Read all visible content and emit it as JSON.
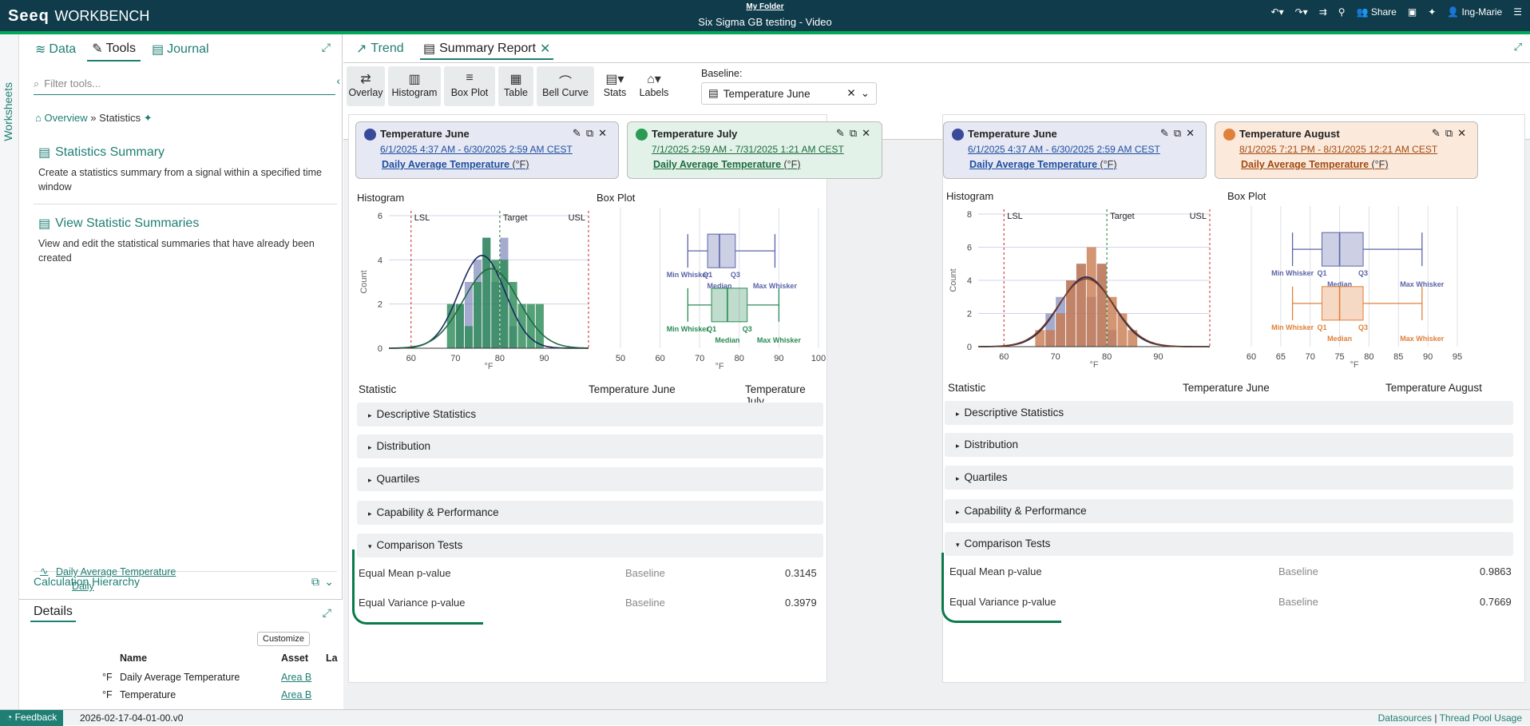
{
  "app": {
    "logo_seeq": "Seeq",
    "logo_workbench": "WORKBENCH",
    "folder": "My Folder",
    "title": "Six Sigma GB testing - Video",
    "share_label": "Share",
    "user": "Ing-Marie"
  },
  "sidebar": {
    "worksheets_label": "Worksheets"
  },
  "left": {
    "tabs": [
      {
        "label": "Data",
        "icon": "database-icon"
      },
      {
        "label": "Tools",
        "icon": "wrench-icon"
      },
      {
        "label": "Journal",
        "icon": "journal-icon"
      }
    ],
    "filter_placeholder": "Filter tools...",
    "breadcrumb": {
      "root": "Overview",
      "sep": "»",
      "current": "Statistics"
    },
    "tools": [
      {
        "title": "Statistics Summary",
        "desc": "Create a statistics summary from a signal within a specified time window"
      },
      {
        "title": "View Statistic Summaries",
        "desc": "View and edit the statistical summaries that have already been created"
      }
    ],
    "calc_title": "Calculation Hierarchy",
    "calc_items": [
      "Daily Average Temperature",
      "Daily"
    ]
  },
  "details": {
    "tab": "Details",
    "customize": "Customize",
    "headers": {
      "name": "Name",
      "asset": "Asset",
      "la": "La"
    },
    "rows": [
      {
        "unit": "°F",
        "name": "Daily Average Temperature",
        "asset": "Area B"
      },
      {
        "unit": "°F",
        "name": "Temperature",
        "asset": "Area B"
      }
    ]
  },
  "status": {
    "feedback": "Feedback",
    "version": "2026-02-17-04-01-00.v0",
    "datasources": "Datasources",
    "sep": "|",
    "thread": "Thread Pool Usage"
  },
  "main": {
    "tabs": [
      {
        "label": "Trend"
      },
      {
        "label": "Summary Report"
      }
    ],
    "toolbar": [
      {
        "label": "Overlay",
        "icon": "swap-icon"
      },
      {
        "label": "Histogram",
        "icon": "histogram-icon"
      },
      {
        "label": "Box Plot",
        "icon": "list-icon"
      },
      {
        "label": "Table",
        "icon": "table-icon"
      },
      {
        "label": "Bell Curve",
        "icon": "bell-icon"
      }
    ],
    "stats_label": "Stats",
    "labels_label": "Labels",
    "baseline_label": "Baseline:",
    "baseline_value": "Temperature June"
  },
  "panels": [
    {
      "sig1": {
        "name": "Temperature June",
        "range": "6/1/2025 4:37 AM - 6/30/2025 2:59 AM CEST",
        "asset": "Daily Average Temperature",
        "unit": "(°F)"
      },
      "sig2": {
        "name": "Temperature July",
        "range": "7/1/2025 2:59 AM - 7/31/2025 1:21 AM CEST",
        "asset": "Daily Average Temperature",
        "unit": "(°F)"
      },
      "hist_title": "Histogram",
      "box_title": "Box Plot",
      "stat_header": "Statistic",
      "col1": "Temperature June",
      "col2": "Temperature July",
      "sections": [
        "Descriptive Statistics",
        "Distribution",
        "Quartiles",
        "Capability & Performance",
        "Comparison Tests"
      ],
      "tests": [
        {
          "name": "Equal Mean p-value",
          "base": "Baseline",
          "value": "0.3145"
        },
        {
          "name": "Equal Variance p-value",
          "base": "Baseline",
          "value": "0.3979"
        }
      ]
    },
    {
      "sig1": {
        "name": "Temperature June",
        "range": "6/1/2025 4:37 AM - 6/30/2025 2:59 AM CEST",
        "asset": "Daily Average Temperature",
        "unit": "(°F)"
      },
      "sig2": {
        "name": "Temperature August",
        "range": "8/1/2025 7:21 PM - 8/31/2025 12:21 AM CEST",
        "asset": "Daily Average Temperature",
        "unit": "(°F)"
      },
      "hist_title": "Histogram",
      "box_title": "Box Plot",
      "stat_header": "Statistic",
      "col1": "Temperature June",
      "col2": "Temperature August",
      "sections": [
        "Descriptive Statistics",
        "Distribution",
        "Quartiles",
        "Capability & Performance",
        "Comparison Tests"
      ],
      "tests": [
        {
          "name": "Equal Mean p-value",
          "base": "Baseline",
          "value": "0.9863"
        },
        {
          "name": "Equal Variance p-value",
          "base": "Baseline",
          "value": "0.7669"
        }
      ]
    }
  ],
  "chart_data": [
    {
      "type": "bar",
      "title": "Histogram",
      "xlabel": "°F",
      "ylabel": "Count",
      "xlim": [
        55,
        100
      ],
      "ylim": [
        0,
        6
      ],
      "xticks": [
        60,
        70,
        80,
        90
      ],
      "yticks": [
        0,
        2,
        4,
        6
      ],
      "limits": [
        {
          "name": "LSL",
          "x": 60
        },
        {
          "name": "Target",
          "x": 80
        },
        {
          "name": "USL",
          "x": 100
        }
      ],
      "bin_width": 2,
      "bins": [
        68,
        70,
        72,
        74,
        76,
        78,
        80,
        82,
        84,
        86,
        88,
        90
      ],
      "series": [
        {
          "name": "Temperature June",
          "color": "#5b64a8",
          "values": [
            0,
            2,
            3,
            4,
            5,
            3,
            5,
            1,
            0,
            0,
            0,
            0
          ]
        },
        {
          "name": "Temperature July",
          "color": "#2a8a55",
          "values": [
            2,
            2,
            1,
            3,
            5,
            4,
            4,
            3,
            2,
            2,
            2,
            0
          ]
        }
      ],
      "bell": [
        {
          "color": "#1a2a5e",
          "mean": 76,
          "sd": 5.2,
          "peak": 4.2
        },
        {
          "color": "#1d6b40",
          "mean": 78,
          "sd": 6.2,
          "peak": 3.6
        }
      ]
    },
    {
      "type": "box",
      "title": "Box Plot",
      "xlabel": "°F",
      "xlim": [
        50,
        100
      ],
      "xticks": [
        50,
        60,
        70,
        80,
        90,
        100
      ],
      "series": [
        {
          "name": "Temperature June",
          "color": "#5b64a8",
          "min": 67,
          "q1": 72,
          "median": 75,
          "q3": 79,
          "max": 89
        },
        {
          "name": "Temperature July",
          "color": "#2a8a55",
          "min": 67,
          "q1": 73,
          "median": 77,
          "q3": 82,
          "max": 90
        }
      ],
      "labels": {
        "min": "Min Whisker",
        "q1": "Q1",
        "median": "Median",
        "q3": "Q3",
        "max": "Max Whisker"
      }
    },
    {
      "type": "bar",
      "title": "Histogram",
      "xlabel": "°F",
      "ylabel": "Count",
      "xlim": [
        55,
        100
      ],
      "ylim": [
        0,
        8
      ],
      "xticks": [
        60,
        70,
        80,
        90
      ],
      "yticks": [
        0,
        2,
        4,
        6,
        8
      ],
      "limits": [
        {
          "name": "LSL",
          "x": 60
        },
        {
          "name": "Target",
          "x": 80
        },
        {
          "name": "USL",
          "x": 100
        }
      ],
      "bin_width": 2,
      "bins": [
        66,
        68,
        70,
        72,
        74,
        76,
        78,
        80,
        82,
        84,
        86,
        88
      ],
      "series": [
        {
          "name": "Temperature June",
          "color": "#5b64a8",
          "values": [
            0,
            2,
            3,
            4,
            5,
            3,
            5,
            1,
            0,
            0,
            0,
            0
          ]
        },
        {
          "name": "Temperature August",
          "color": "#c87a4f",
          "values": [
            1,
            1,
            2,
            4,
            5,
            6,
            5,
            3,
            2,
            1,
            0,
            0
          ]
        }
      ],
      "bell": [
        {
          "color": "#1a2a5e",
          "mean": 76,
          "sd": 5.2,
          "peak": 4.2
        },
        {
          "color": "#7a3b1e",
          "mean": 76,
          "sd": 5.4,
          "peak": 4.1
        }
      ]
    },
    {
      "type": "box",
      "title": "Box Plot",
      "xlabel": "°F",
      "xlim": [
        60,
        95
      ],
      "xticks": [
        60,
        65,
        70,
        75,
        80,
        85,
        90,
        95
      ],
      "series": [
        {
          "name": "Temperature June",
          "color": "#5b64a8",
          "min": 67,
          "q1": 72,
          "median": 75,
          "q3": 79,
          "max": 89
        },
        {
          "name": "Temperature August",
          "color": "#e0803a",
          "min": 67,
          "q1": 72,
          "median": 75,
          "q3": 79,
          "max": 89
        }
      ],
      "labels": {
        "min": "Min Whisker",
        "q1": "Q1",
        "median": "Median",
        "q3": "Q3",
        "max": "Max Whisker"
      }
    }
  ]
}
